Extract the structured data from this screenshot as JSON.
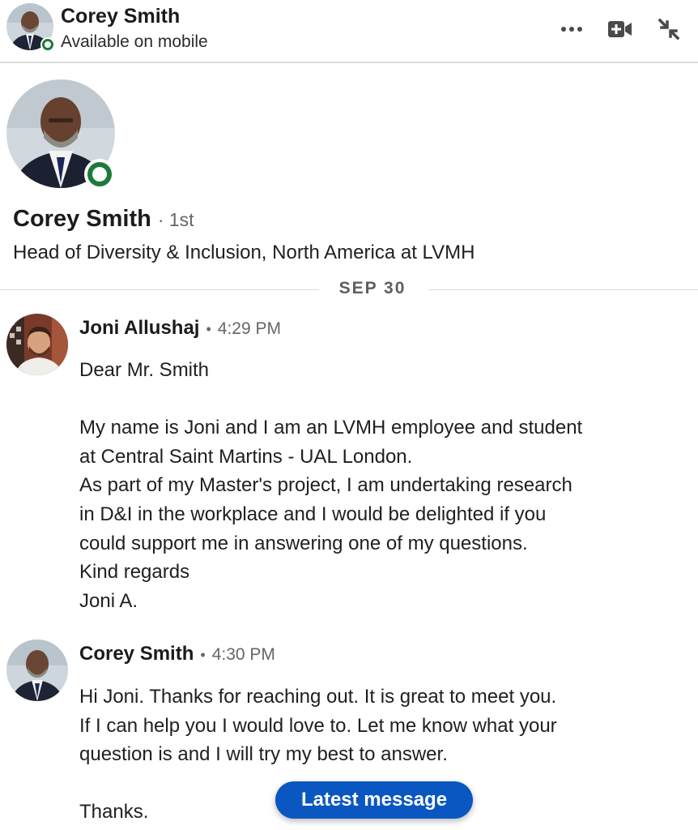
{
  "header": {
    "name": "Corey Smith",
    "status": "Available on mobile",
    "icons": [
      "more-icon",
      "video-call-icon",
      "minimize-icon"
    ]
  },
  "profile": {
    "name": "Corey Smith",
    "degree": "· 1st",
    "headline": "Head of Diversity & Inclusion, North America at LVMH"
  },
  "divider": {
    "date": "SEP 30"
  },
  "messages": [
    {
      "sender": "Joni Allushaj",
      "time": "4:29 PM",
      "lines": [
        "Dear Mr. Smith",
        "",
        "My name is Joni and I am an LVMH employee and student",
        "at Central Saint Martins - UAL London.",
        "As part of my Master's project, I am undertaking research",
        "in D&I in the workplace and I would be delighted if you",
        "could support me in answering one of my questions.",
        "Kind regards",
        "Joni A."
      ]
    },
    {
      "sender": "Corey Smith",
      "time": "4:30 PM",
      "lines": [
        "Hi Joni. Thanks for reaching out. It is great to meet you.",
        "If I can help you I would love to. Let me know what your",
        "question is and I will try my best to answer.",
        "",
        "Thanks."
      ]
    }
  ],
  "latest_button": {
    "label": "Latest message"
  },
  "colors": {
    "presence_green": "#1e7a3a",
    "accent_blue": "#0a57c2",
    "divider_gray": "#dcdcdc"
  }
}
